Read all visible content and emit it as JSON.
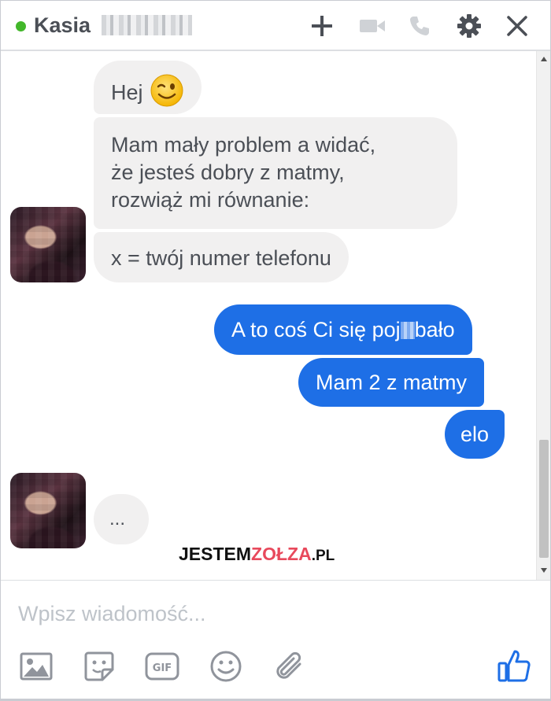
{
  "header": {
    "contact_name": "Kasia",
    "status": "online",
    "icons": [
      "add-person-icon",
      "video-call-icon",
      "audio-call-icon",
      "gear-icon",
      "close-icon"
    ]
  },
  "messages": [
    {
      "direction": "in",
      "text": "Hej",
      "emoji": "winking-face-emoji"
    },
    {
      "direction": "in",
      "lines": [
        "Mam mały problem a widać,",
        "że jesteś dobry z matmy,",
        "rozwiąż mi równanie:"
      ]
    },
    {
      "direction": "in",
      "text": "x = twój numer telefonu"
    },
    {
      "direction": "out",
      "text_before": "A to coś Ci się poj",
      "text_after": "bało"
    },
    {
      "direction": "out",
      "text": "Mam 2 z matmy"
    },
    {
      "direction": "out",
      "text": "elo"
    },
    {
      "direction": "in",
      "text": "...",
      "typing": true
    }
  ],
  "watermark": {
    "part1": "JESTEM",
    "part2": "ZOŁZA",
    "part3": ".PL"
  },
  "composer": {
    "placeholder": "Wpisz wiadomość...",
    "tools": [
      "photo-icon",
      "sticker-icon",
      "gif-icon",
      "emoji-icon",
      "attachment-icon"
    ],
    "send_icon": "thumbs-up-icon"
  },
  "colors": {
    "outgoing_bubble": "#1e6fe6",
    "incoming_bubble": "#f1f0f0",
    "online": "#42b72a",
    "watermark_accent": "#e8495c"
  }
}
